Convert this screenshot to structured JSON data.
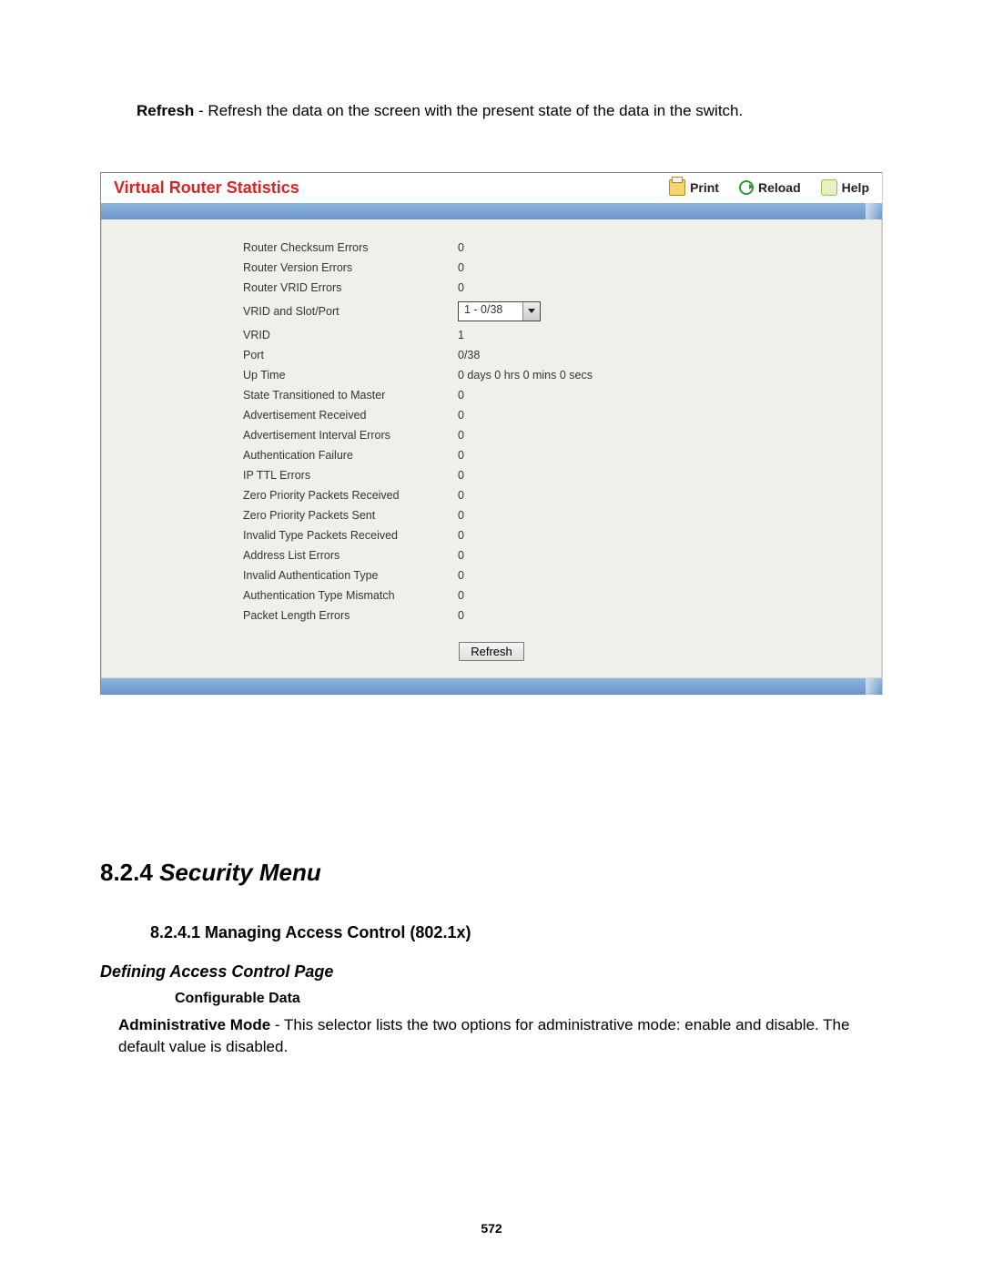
{
  "intro": {
    "lead": "Refresh",
    "rest": " - Refresh the data on the screen with the present state of the data in the switch."
  },
  "panel": {
    "title": "Virtual Router Statistics",
    "print_label": "Print",
    "reload_label": "Reload",
    "help_label": "Help"
  },
  "stats": {
    "rows": [
      {
        "label": "Router Checksum Errors",
        "value": "0",
        "type": "text"
      },
      {
        "label": "Router Version Errors",
        "value": "0",
        "type": "text"
      },
      {
        "label": "Router VRID Errors",
        "value": "0",
        "type": "text"
      },
      {
        "label": "VRID and Slot/Port",
        "value": "1 - 0/38",
        "type": "select"
      },
      {
        "label": "VRID",
        "value": "1",
        "type": "text"
      },
      {
        "label": "Port",
        "value": "0/38",
        "type": "text"
      },
      {
        "label": "Up Time",
        "value": "0 days 0 hrs 0 mins 0 secs",
        "type": "text"
      },
      {
        "label": "State Transitioned to Master",
        "value": "0",
        "type": "text"
      },
      {
        "label": "Advertisement Received",
        "value": "0",
        "type": "text"
      },
      {
        "label": "Advertisement Interval Errors",
        "value": "0",
        "type": "text"
      },
      {
        "label": "Authentication Failure",
        "value": "0",
        "type": "text"
      },
      {
        "label": "IP TTL Errors",
        "value": "0",
        "type": "text"
      },
      {
        "label": "Zero Priority Packets Received",
        "value": "0",
        "type": "text"
      },
      {
        "label": "Zero Priority Packets Sent",
        "value": "0",
        "type": "text"
      },
      {
        "label": "Invalid Type Packets Received",
        "value": "0",
        "type": "text"
      },
      {
        "label": "Address List Errors",
        "value": "0",
        "type": "text"
      },
      {
        "label": "Invalid Authentication Type",
        "value": "0",
        "type": "text"
      },
      {
        "label": "Authentication Type Mismatch",
        "value": "0",
        "type": "text"
      },
      {
        "label": "Packet Length Errors",
        "value": "0",
        "type": "text"
      }
    ],
    "refresh_label": "Refresh"
  },
  "doc": {
    "section_num": "8.2.4",
    "section_title": "Security Menu",
    "sub_num_title": "8.2.4.1 Managing Access Control (802.1x)",
    "sub2_title": "Defining Access Control Page",
    "sub3_title": "Configurable Data",
    "para_lead": "Administrative Mode",
    "para_rest": " - This selector lists the two options for administrative mode: enable and disable. The default value is disabled.",
    "page_number": "572"
  }
}
